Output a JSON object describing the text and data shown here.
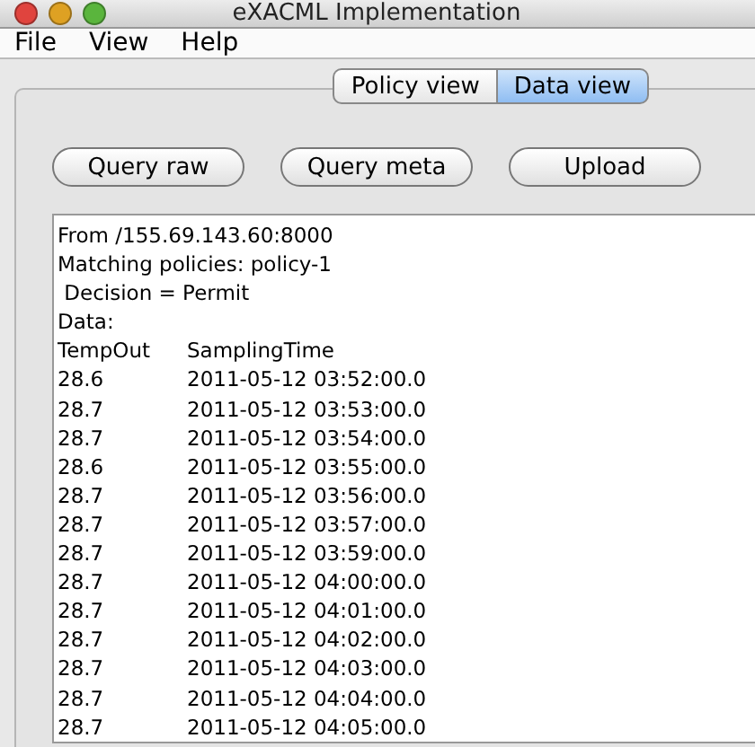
{
  "window": {
    "title": "eXACML Implementation"
  },
  "menu": [
    "File",
    "View",
    "Help"
  ],
  "tabs": [
    {
      "label": "Policy view",
      "selected": false
    },
    {
      "label": "Data view",
      "selected": true
    }
  ],
  "buttons": [
    "Query raw",
    "Query meta",
    "Upload"
  ],
  "output": {
    "header_lines": [
      "From /155.69.143.60:8000",
      "Matching policies: policy-1",
      " Decision = Permit",
      "Data:"
    ],
    "columns": [
      "TempOut",
      "SamplingTime"
    ],
    "rows": [
      [
        "28.6",
        "2011-05-12 03:52:00.0"
      ],
      [
        "28.7",
        "2011-05-12 03:53:00.0"
      ],
      [
        "28.7",
        "2011-05-12 03:54:00.0"
      ],
      [
        "28.6",
        "2011-05-12 03:55:00.0"
      ],
      [
        "28.7",
        "2011-05-12 03:56:00.0"
      ],
      [
        "28.7",
        "2011-05-12 03:57:00.0"
      ],
      [
        "28.7",
        "2011-05-12 03:59:00.0"
      ],
      [
        "28.7",
        "2011-05-12 04:00:00.0"
      ],
      [
        "28.7",
        "2011-05-12 04:01:00.0"
      ],
      [
        "28.7",
        "2011-05-12 04:02:00.0"
      ],
      [
        "28.7",
        "2011-05-12 04:03:00.0"
      ],
      [
        "28.7",
        "2011-05-12 04:04:00.0"
      ],
      [
        "28.7",
        "2011-05-12 04:05:00.0"
      ]
    ]
  }
}
